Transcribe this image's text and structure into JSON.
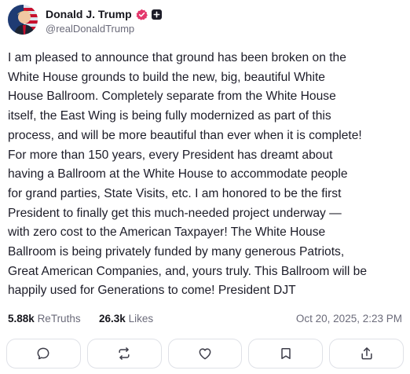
{
  "author": {
    "name": "Donald J. Trump",
    "handle": "@realDonaldTrump"
  },
  "post": {
    "text": "I am pleased to announce that ground has been broken on the\nWhite House grounds to build the new, big, beautiful White\nHouse Ballroom. Completely separate from the White House\nitself, the East Wing is being fully modernized as part of this\nprocess, and will be more beautiful than ever when it is complete!\nFor more than 150 years, every President has dreamt about\nhaving a Ballroom at the White House to accommodate people\nfor grand parties, State Visits, etc. I am honored to be the first\nPresident to finally get this much-needed project underway —\nwith zero cost to the American Taxpayer! The White House\nBallroom is being privately funded by many generous Patriots,\nGreat American Companies, and, yours truly. This Ballroom will be\nhappily used for Generations to come! President DJT"
  },
  "stats": {
    "retruths_count": "5.88k",
    "retruths_label": "ReTruths",
    "likes_count": "26.3k",
    "likes_label": "Likes",
    "timestamp": "Oct 20, 2025, 2:23 PM"
  },
  "icons": {
    "verified": "verified-badge-icon",
    "badge": "plus-badge-icon",
    "reply": "comment-icon",
    "retruth": "retruth-icon",
    "like": "heart-icon",
    "bookmark": "bookmark-icon",
    "share": "share-icon"
  },
  "colors": {
    "verified": "#e3376b",
    "text": "#1c1c28",
    "muted": "#6b6b7a",
    "border": "#dfe1e7"
  }
}
